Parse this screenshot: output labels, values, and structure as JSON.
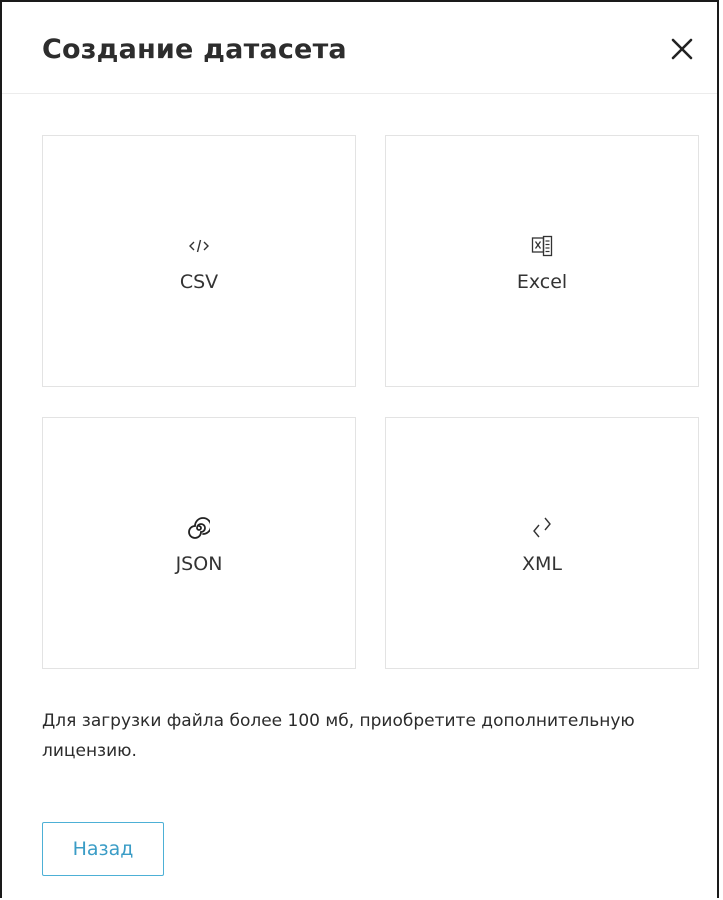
{
  "dialog": {
    "title": "Создание датасета",
    "close_icon": "close-icon"
  },
  "tiles": [
    {
      "id": "csv",
      "label": "CSV",
      "icon": "code-icon"
    },
    {
      "id": "excel",
      "label": "Excel",
      "icon": "excel-icon"
    },
    {
      "id": "json",
      "label": "JSON",
      "icon": "spiral-icon"
    },
    {
      "id": "xml",
      "label": "XML",
      "icon": "angle-brackets-icon"
    }
  ],
  "note": "Для загрузки файла более 100 мб, приобретите дополнительную лицензию.",
  "footer": {
    "back_label": "Назад"
  },
  "colors": {
    "accent": "#3a9cc6",
    "accent_border": "#4db0d6",
    "tile_border": "#e3e3e3",
    "text": "#2b2b2b"
  }
}
